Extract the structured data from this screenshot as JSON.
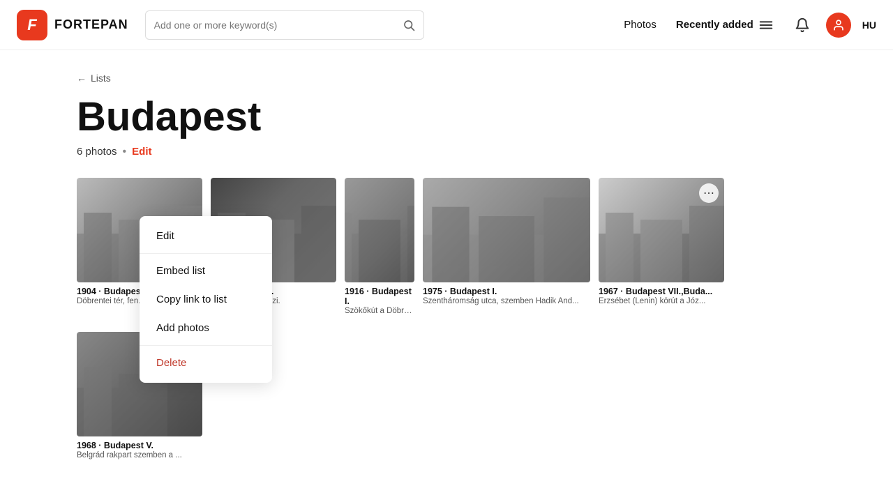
{
  "header": {
    "logo_letter": "F",
    "logo_name": "FORTEPAN",
    "search_placeholder": "Add one or more keyword(s)",
    "nav": {
      "photos_label": "Photos",
      "recently_added_label": "Recently added"
    },
    "lang": "HU"
  },
  "breadcrumb": {
    "arrow": "←",
    "link_label": "Lists"
  },
  "page": {
    "title": "Budapest",
    "photos_count": "6 photos",
    "dot": "•",
    "edit_label": "Edit"
  },
  "dropdown": {
    "items": [
      {
        "id": "edit",
        "label": "Edit"
      },
      {
        "id": "embed",
        "label": "Embed list"
      },
      {
        "id": "copy",
        "label": "Copy link to list"
      },
      {
        "id": "add",
        "label": "Add photos"
      },
      {
        "id": "delete",
        "label": "Delete",
        "type": "danger"
      }
    ]
  },
  "photos": [
    {
      "id": 1,
      "year_loc": "1904 · Budapest",
      "desc": "Döbrentei tér, fen...",
      "size": "large",
      "ph": "ph1",
      "show_dots": false
    },
    {
      "id": 2,
      "year_loc": "· Budapest VIII.",
      "desc": "ut 21., Uránia mozi.",
      "size": "large",
      "ph": "ph2",
      "show_dots": false
    },
    {
      "id": 3,
      "year_loc": "1916 · Budapest I.",
      "desc": "Szökőkút a Döbrent...",
      "size": "sq",
      "ph": "ph3",
      "show_dots": false
    },
    {
      "id": 4,
      "year_loc": "1975 · Budapest I.",
      "desc": "Szentháromság utca, szemben Hadik And...",
      "size": "large",
      "ph": "ph4",
      "show_dots": false
    },
    {
      "id": 5,
      "year_loc": "1967 · Budapest VII.,Buda...",
      "desc": "Erzsébet (Lenin) körút a Józ...",
      "size": "large",
      "ph": "ph5",
      "show_dots": true
    },
    {
      "id": 6,
      "year_loc": "1968 · Budapest V.",
      "desc": "Belgrád rakpart szemben a ...",
      "size": "large",
      "ph": "ph6",
      "show_dots": true
    }
  ]
}
